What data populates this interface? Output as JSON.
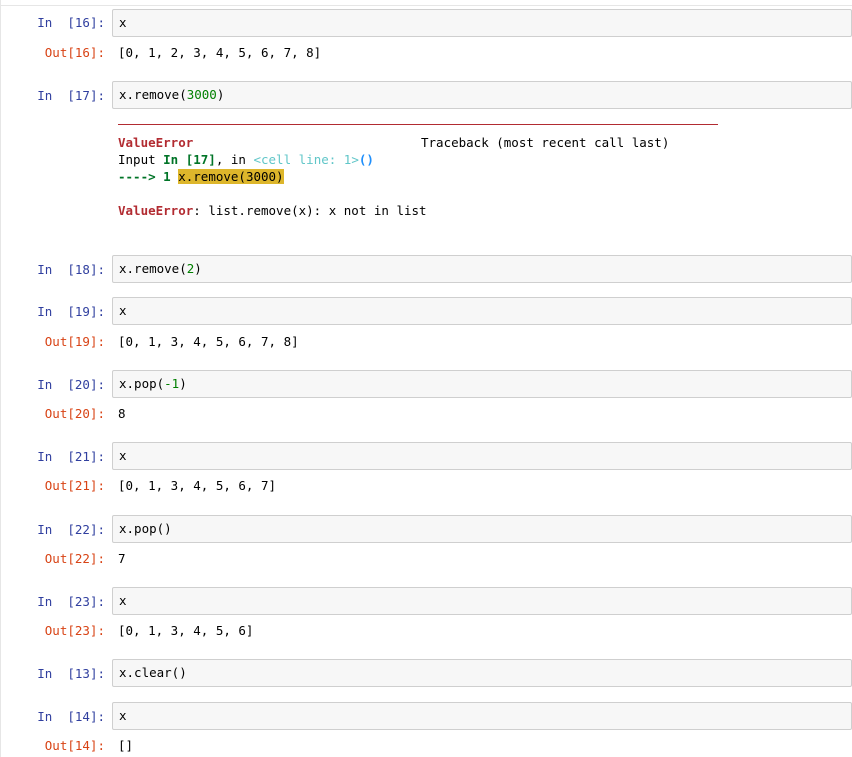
{
  "cells": [
    {
      "in": "In  [16]:",
      "code": "x",
      "out_prompt": "Out[16]:",
      "out": "[0, 1, 2, 3, 4, 5, 6, 7, 8]"
    },
    {
      "in": "In  [17]:",
      "code_prefix": "x.remove(",
      "code_num": "3000",
      "code_suffix": ")"
    },
    {
      "in": "In  [18]:",
      "code_prefix": "x.remove(",
      "code_num": "2",
      "code_suffix": ")"
    },
    {
      "in": "In  [19]:",
      "code": "x",
      "out_prompt": "Out[19]:",
      "out": "[0, 1, 3, 4, 5, 6, 7, 8]"
    },
    {
      "in": "In  [20]:",
      "code_prefix": "x.pop(",
      "code_num": "-1",
      "code_suffix": ")",
      "out_prompt": "Out[20]:",
      "out": "8"
    },
    {
      "in": "In  [21]:",
      "code": "x",
      "out_prompt": "Out[21]:",
      "out": "[0, 1, 3, 4, 5, 6, 7]"
    },
    {
      "in": "In  [22]:",
      "code": "x.pop()",
      "out_prompt": "Out[22]:",
      "out": "7"
    },
    {
      "in": "In  [23]:",
      "code": "x",
      "out_prompt": "Out[23]:",
      "out": "[0, 1, 3, 4, 5, 6]"
    },
    {
      "in": "In  [13]:",
      "code": "x.clear()"
    },
    {
      "in": "In  [14]:",
      "code": "x",
      "out_prompt": "Out[14]:",
      "out": "[]"
    }
  ],
  "traceback": {
    "error_name": "ValueError",
    "header_right": "Traceback (most recent call last)",
    "input_word": "Input ",
    "input_ref": "In [17]",
    "comma_in": ", in ",
    "cell_line": "<cell line: 1>",
    "parens": "()",
    "arrow_line": "----> 1 ",
    "highlighted_code": "x.remove(3000)",
    "error_message": ": list.remove(x): x not in list"
  },
  "colors": {
    "in_prompt": "#303F9F",
    "out_prompt": "#D84315",
    "number": "#008000",
    "error": "#b22b31",
    "highlight": "#ddb62b"
  }
}
